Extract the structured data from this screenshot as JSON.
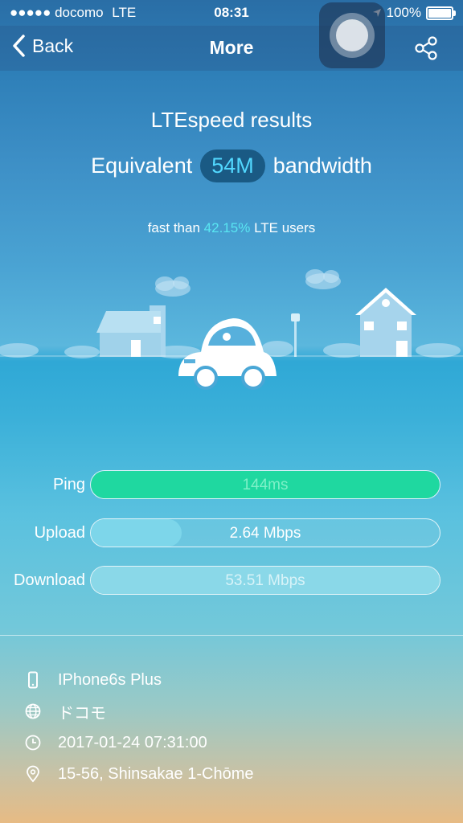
{
  "status": {
    "signal": "●●●●●",
    "carrier": "docomo",
    "network": "LTE",
    "time": "08:31",
    "battery": "100%"
  },
  "nav": {
    "back_label": "Back",
    "title": "More"
  },
  "results": {
    "title": "LTEspeed results",
    "prefix": "Equivalent",
    "bandwidth": "54M",
    "suffix": "bandwidth",
    "fast_prefix": "fast than",
    "percent": "42.15%",
    "fast_suffix": "LTE users"
  },
  "metrics": [
    {
      "label": "Ping",
      "value": "144ms",
      "fill_fraction": 1.0
    },
    {
      "label": "Upload",
      "value": "2.64 Mbps",
      "fill_fraction": 0.26
    },
    {
      "label": "Download",
      "value": "53.51 Mbps",
      "fill_fraction": 1.0
    }
  ],
  "info": [
    {
      "icon": "phone-icon",
      "text": "IPhone6s Plus"
    },
    {
      "icon": "globe-icon",
      "text": "ドコモ"
    },
    {
      "icon": "clock-icon",
      "text": "2017-01-24 07:31:00"
    },
    {
      "icon": "location-pin-icon",
      "text": "15-56, Shinsakae 1-Chōme"
    }
  ]
}
